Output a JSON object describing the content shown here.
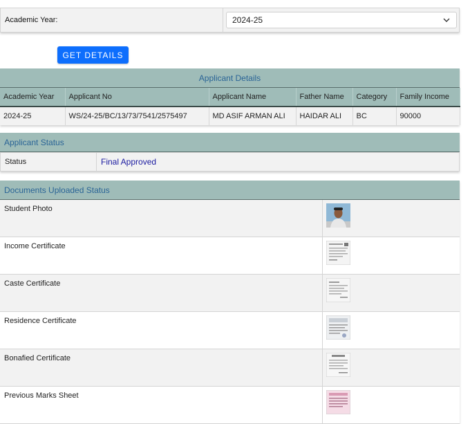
{
  "academic_year": {
    "label": "Academic Year:",
    "selected": "2024-25"
  },
  "get_details_label": "GET DETAILS",
  "applicant_details": {
    "title": "Applicant Details",
    "columns": [
      "Academic Year",
      "Applicant No",
      "Applicant Name",
      "Father Name",
      "Category",
      "Family Income"
    ],
    "row": [
      "2024-25",
      "WS/24-25/BC/13/73/7541/2575497",
      "MD ASIF ARMAN ALI",
      "HAIDAR ALI",
      "BC",
      "90000"
    ]
  },
  "applicant_status": {
    "title": "Applicant Status",
    "label": "Status",
    "value": "Final Approved"
  },
  "documents": {
    "title": "Documents Uploaded Status",
    "items": [
      {
        "name": "Student Photo",
        "thumb": "photo"
      },
      {
        "name": "Income Certificate",
        "thumb": "doc"
      },
      {
        "name": "Caste Certificate",
        "thumb": "doc"
      },
      {
        "name": "Residence Certificate",
        "thumb": "doc"
      },
      {
        "name": "Bonafied Certificate",
        "thumb": "doc"
      },
      {
        "name": "Previous Marks Sheet",
        "thumb": "pink-doc"
      }
    ]
  },
  "colors": {
    "header_bg": "#9fbcb8",
    "header_text": "#2a6496",
    "button": "#0d6efd",
    "status_text": "#1a1aa0"
  }
}
